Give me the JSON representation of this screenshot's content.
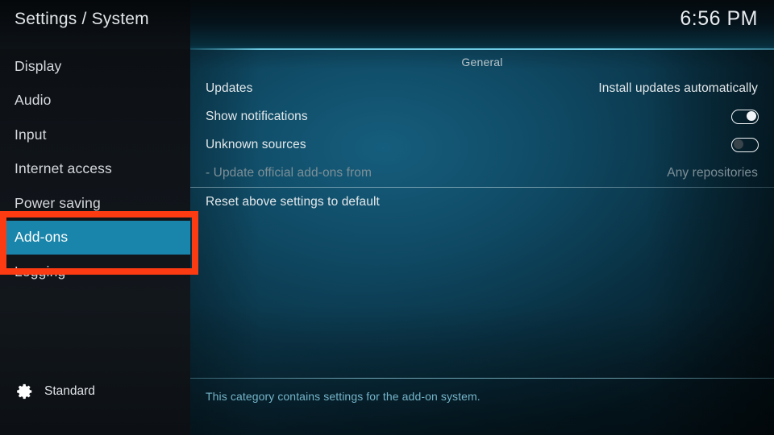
{
  "header": {
    "title": "Settings / System",
    "clock": "6:56 PM"
  },
  "sidebar": {
    "items": [
      {
        "label": "Display",
        "selected": false
      },
      {
        "label": "Audio",
        "selected": false
      },
      {
        "label": "Input",
        "selected": false
      },
      {
        "label": "Internet access",
        "selected": false
      },
      {
        "label": "Power saving",
        "selected": false
      },
      {
        "label": "Add-ons",
        "selected": true
      },
      {
        "label": "Logging",
        "selected": false
      }
    ],
    "profile": {
      "icon": "gear-icon",
      "label": "Standard"
    }
  },
  "main": {
    "group_title": "General",
    "rows": [
      {
        "label": "Updates",
        "control": "value",
        "value": "Install updates automatically",
        "disabled": false
      },
      {
        "label": "Show notifications",
        "control": "toggle",
        "value": "on",
        "disabled": false
      },
      {
        "label": "Unknown sources",
        "control": "toggle",
        "value": "off",
        "disabled": false
      },
      {
        "label": "- Update official add-ons from",
        "control": "value",
        "value": "Any repositories",
        "disabled": true
      },
      {
        "label": "Reset above settings to default",
        "control": "none",
        "value": "",
        "disabled": false
      }
    ],
    "footer_description": "This category contains settings for the add-on system."
  },
  "annotation": {
    "type": "highlight-box",
    "color": "#fc3b12",
    "targets": "sidebar-item-add-ons"
  },
  "colors": {
    "selection": "#1a85ab",
    "annotation": "#fc3b12",
    "accent_rule": "#76d6ee",
    "footer_text": "#74b4c9",
    "sidebar_bg": "#0f1318"
  }
}
